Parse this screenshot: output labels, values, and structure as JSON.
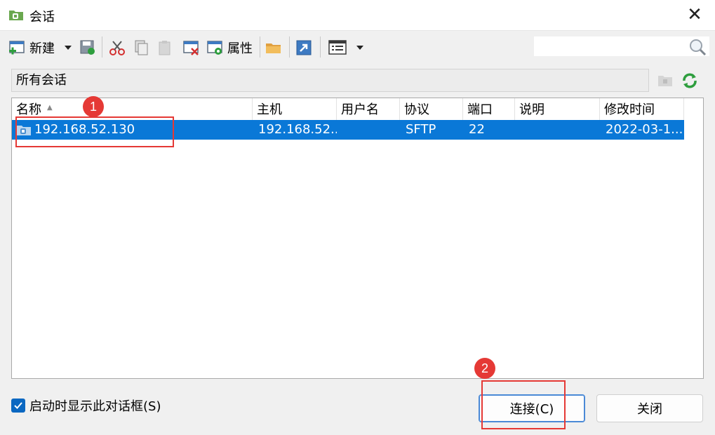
{
  "window": {
    "title": "会话",
    "close_glyph": "✕"
  },
  "toolbar": {
    "new_label": "新建",
    "properties_label": "属性",
    "icons": [
      "new-session-icon",
      "dropdown-icon",
      "save-icon",
      "cut-icon",
      "copy-icon",
      "paste-icon",
      "delete-icon",
      "properties-icon",
      "folder-icon",
      "shortcut-icon",
      "view-icon",
      "dropdown-icon"
    ]
  },
  "search": {
    "placeholder": ""
  },
  "path": {
    "label": "所有会话"
  },
  "table": {
    "columns": [
      "名称",
      "主机",
      "用户名",
      "协议",
      "端口",
      "说明",
      "修改时间"
    ],
    "rows": [
      {
        "name": "192.168.52.130",
        "host": "192.168.52...",
        "user": "",
        "protocol": "SFTP",
        "port": "22",
        "desc": "",
        "modified": "2022-03-1..."
      }
    ]
  },
  "footer": {
    "show_on_startup": "启动时显示此对话框(S)",
    "connect": "连接(C)",
    "close": "关闭"
  },
  "annotations": {
    "badge1": "1",
    "badge2": "2"
  },
  "colors": {
    "selection": "#0a78d7",
    "annotation": "#e53935",
    "checkbox": "#0a67c1"
  }
}
